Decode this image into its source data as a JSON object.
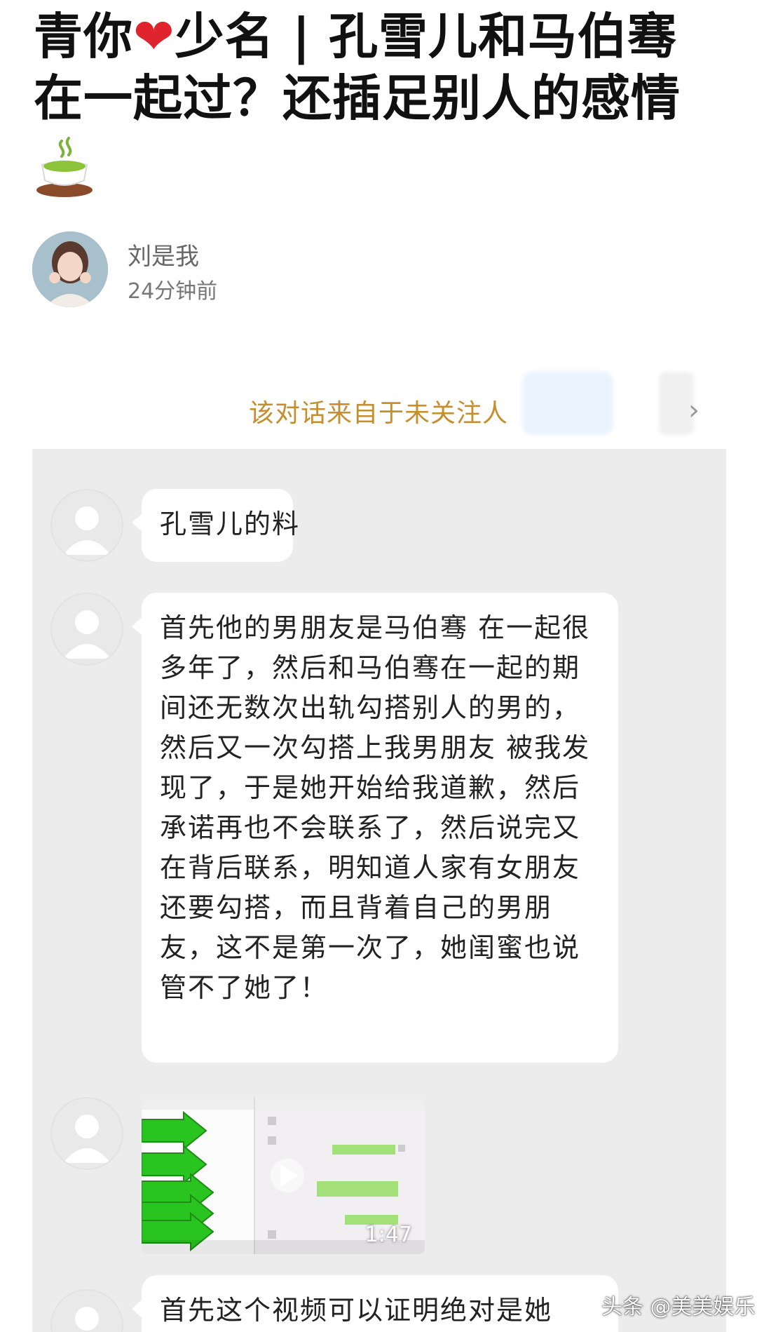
{
  "post": {
    "title_line1_part1": "青你",
    "title_heart": "❤️",
    "title_line1_part2": "少名 | 孔雪儿和马伯骞",
    "title_line2": "在一起过？还插足别人的感情",
    "title_emoji": "🍵"
  },
  "author": {
    "name": "刘是我",
    "time": "24分钟前"
  },
  "notice": {
    "text": "该对话来自于未关注人"
  },
  "messages": [
    {
      "type": "text",
      "text": "孔雪儿的料"
    },
    {
      "type": "text",
      "text": "首先他的男朋友是马伯骞 在一起很多年了，然后和马伯骞在一起的期间还无数次出轨勾搭别人的男的，然后又一次勾搭上我男朋友 被我发现了，于是她开始给我道歉，然后承诺再也不会联系了，然后说完又在背后联系，明知道人家有女朋友还要勾搭，而且背着自己的男朋友，这不是第一次了，她闺蜜也说管不了她了！"
    },
    {
      "type": "video",
      "duration": "1:47"
    },
    {
      "type": "text",
      "text": "首先这个视频可以证明绝对是她"
    }
  ],
  "watermark": "头条 @美美娱乐",
  "colors": {
    "notice": "#c68e2c",
    "chat_bg": "#ececec",
    "bubble": "#ffffff"
  }
}
